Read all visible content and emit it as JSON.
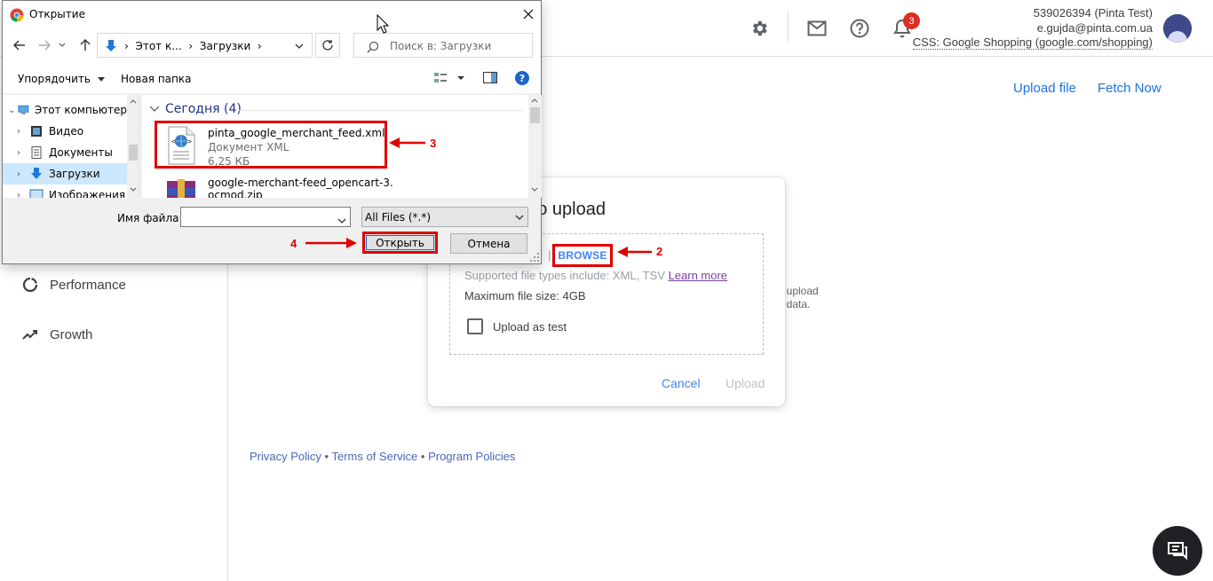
{
  "account": {
    "id_line": "539026394 (Pinta Test)",
    "email": "e.gujda@pinta.com.ua",
    "css": "CSS: Google Shopping (google.com/shopping)",
    "notifications_count": "3"
  },
  "sidebar": {
    "items": [
      {
        "label": "Performance",
        "icon": "performance-icon"
      },
      {
        "label": "Growth",
        "icon": "growth-icon"
      }
    ]
  },
  "header_actions": {
    "upload_file": "Upload file",
    "fetch_now": "Fetch Now"
  },
  "background_text": {
    "line1": ", upload",
    "line2": "t data."
  },
  "footer": {
    "privacy": "Privacy Policy",
    "sep1": " • ",
    "terms": "Terms of Service",
    "sep2": " • ",
    "program": "Program Policies"
  },
  "upload_dialog": {
    "title": "o upload",
    "browse_sep": "|",
    "browse": "BROWSE",
    "supported": "Supported file types include: XML, TSV ",
    "learn_more": "Learn more",
    "max_size": "Maximum file size: 4GB",
    "upload_as_test": "Upload as test",
    "cancel": "Cancel",
    "upload": "Upload"
  },
  "file_dialog": {
    "title": "Открытие",
    "address": {
      "crumb1": "Этот к...",
      "crumb2": "Загрузки",
      "sep": "›"
    },
    "search_placeholder": "Поиск в: Загрузки",
    "commands": {
      "organize": "Упорядочить",
      "new_folder": "Новая папка"
    },
    "tree": [
      {
        "label": "Этот компьютер",
        "icon": "computer-icon",
        "selected": false
      },
      {
        "label": "Видео",
        "icon": "video-folder-icon",
        "selected": false
      },
      {
        "label": "Документы",
        "icon": "documents-folder-icon",
        "selected": false
      },
      {
        "label": "Загрузки",
        "icon": "downloads-folder-icon",
        "selected": true
      },
      {
        "label": "Изображения",
        "icon": "images-folder-icon",
        "selected": false
      }
    ],
    "group": "Сегодня (4)",
    "files": [
      {
        "name": "pinta_google_merchant_feed.xml",
        "type": "Документ XML",
        "size": "6,25 КБ",
        "icon": "xml-file-icon"
      },
      {
        "name": "google-merchant-feed_opencart-3.",
        "name2": "ocmod.zip",
        "icon": "zip-archive-icon"
      }
    ],
    "filename_label": "Имя файла:",
    "filename_value": "",
    "filter": "All Files (*.*)",
    "open": "Открыть",
    "cancel": "Отмена"
  },
  "annotations": {
    "step2": "2",
    "step3": "3",
    "step4": "4",
    "color": "#e00000"
  },
  "colors": {
    "link_blue": "#1a73e8",
    "browse_blue": "#4285f4",
    "selection": "#cce8ff"
  }
}
